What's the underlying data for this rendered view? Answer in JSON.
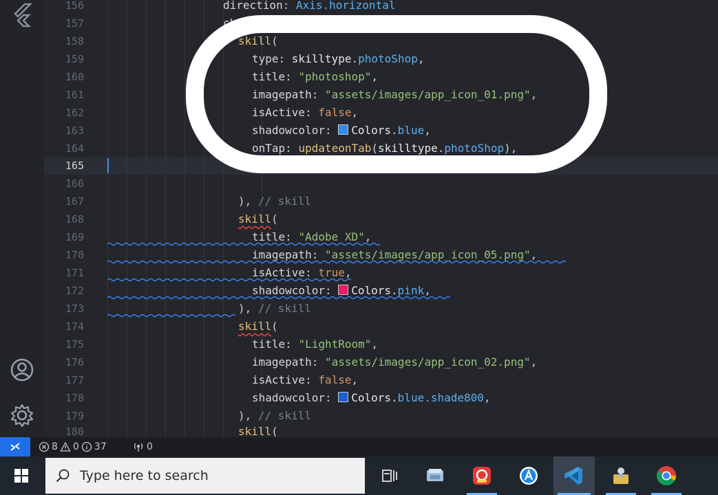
{
  "colors": {
    "editor_bg": "#24262c",
    "blue_swatch": "#2f8be6",
    "pink_swatch": "#e91e63",
    "accent": "#1f6feb"
  },
  "activity_bar": {
    "icons": [
      "flutter-logo-icon",
      "account-icon",
      "settings-gear-icon"
    ]
  },
  "editor": {
    "line_numbers": [
      "156",
      "157",
      "158",
      "159",
      "160",
      "161",
      "162",
      "163",
      "164",
      "165",
      "166",
      "167",
      "168",
      "169",
      "170",
      "171",
      "172",
      "173",
      "174",
      "175",
      "176",
      "177",
      "178",
      "179",
      "180"
    ],
    "active_line": "165",
    "code": {
      "l156": {
        "prop": "direction",
        "colon": ": ",
        "value": "Axis.horizontal"
      },
      "l157": {
        "prop": "children",
        "colon": ": ",
        "value": "["
      },
      "l158": {
        "call": "skill",
        "paren": "("
      },
      "l159": {
        "prop": "type",
        "colon": ": ",
        "type": "skilltype",
        "dot": ".",
        "member": "photoShop",
        "end": ","
      },
      "l160": {
        "prop": "title",
        "colon": ": ",
        "str": "\"photoshop\"",
        "end": ","
      },
      "l161": {
        "prop": "imagepath",
        "colon": ": ",
        "str": "\"assets/images/app_icon_01.png\"",
        "end": ","
      },
      "l162": {
        "prop": "isActive",
        "colon": ": ",
        "kw": "false",
        "end": ","
      },
      "l163": {
        "prop": "shadowcolor",
        "colon": ": ",
        "type": "Colors",
        "dot": ".",
        "member": "blue",
        "end": ","
      },
      "l164": {
        "prop": "onTap",
        "colon": ": ",
        "call": "updateonTab",
        "open": "(",
        "type": "skilltype",
        "dot": ".",
        "member": "photoShop",
        "end": "),"
      },
      "l167": {
        "close": ")",
        "end": ", ",
        "comment": "// skill"
      },
      "l168": {
        "call": "skill",
        "paren": "("
      },
      "l169": {
        "prop": "title",
        "colon": ": ",
        "str": "\"Adobe XD\"",
        "end": ","
      },
      "l170": {
        "prop": "imagepath",
        "colon": ": ",
        "str": "\"assets/images/app_icon_05.png\"",
        "end": ","
      },
      "l171": {
        "prop": "isActive",
        "colon": ": ",
        "kw": "true",
        "end": ","
      },
      "l172": {
        "prop": "shadowcolor",
        "colon": ": ",
        "type": "Colors",
        "dot": ".",
        "member": "pink",
        "end": ","
      },
      "l173": {
        "close": ")",
        "end": ", ",
        "comment": "// skill"
      },
      "l174": {
        "call": "skill",
        "paren": "("
      },
      "l175": {
        "prop": "title",
        "colon": ": ",
        "str": "\"LightRoom\"",
        "end": ","
      },
      "l176": {
        "prop": "imagepath",
        "colon": ": ",
        "str": "\"assets/images/app_icon_02.png\"",
        "end": ","
      },
      "l177": {
        "prop": "isActive",
        "colon": ": ",
        "kw": "false",
        "end": ","
      },
      "l178": {
        "prop": "shadowcolor",
        "colon": ": ",
        "type": "Colors",
        "dot": ".",
        "member": "blue.shade800",
        "end": ","
      },
      "l179": {
        "close": ")",
        "end": ", ",
        "comment": "// skill"
      },
      "l180": {
        "call": "skill",
        "paren": "("
      }
    }
  },
  "status_bar": {
    "errors": "8",
    "warnings": "0",
    "infos": "37",
    "ports": "0"
  },
  "taskbar": {
    "search_placeholder": "Type here to search",
    "apps": [
      "task-view-icon",
      "file-explorer-icon",
      "image-editor-app-icon",
      "browser-a-app-icon",
      "vscode-app-icon",
      "user-folder-app-icon",
      "chrome-app-icon"
    ]
  }
}
